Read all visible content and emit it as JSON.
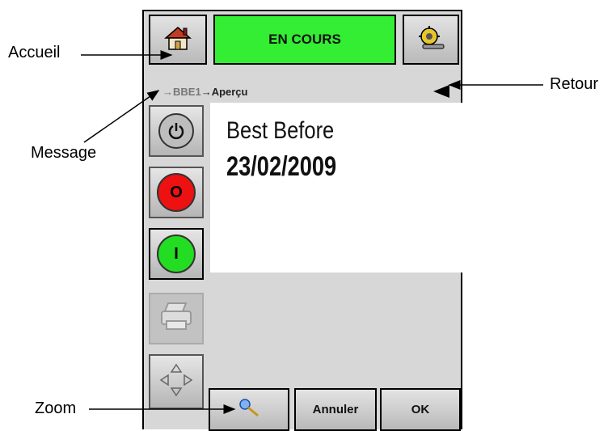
{
  "callouts": {
    "home": "Accueil",
    "back": "Retour",
    "message": "Message",
    "zoom": "Zoom"
  },
  "header": {
    "status": "EN COURS",
    "status_color": "#33ee33"
  },
  "breadcrumb": {
    "prefix": "…",
    "path_1": "→BBE1",
    "path_2": "→Aperçu"
  },
  "preview": {
    "line1": "Best Before",
    "line2": "23/02/2009"
  },
  "buttons": {
    "stop_label": "O",
    "start_label": "I",
    "cancel": "Annuler",
    "ok": "OK"
  },
  "colors": {
    "stop": "#ee1111",
    "start": "#22dd22",
    "panel": "#d7d7d7"
  },
  "icons": [
    "home-icon",
    "settings-gear-icon",
    "back-arrow-icon",
    "power-icon",
    "stop-icon",
    "start-icon",
    "printer-icon",
    "move-arrows-icon",
    "zoom-icon"
  ]
}
